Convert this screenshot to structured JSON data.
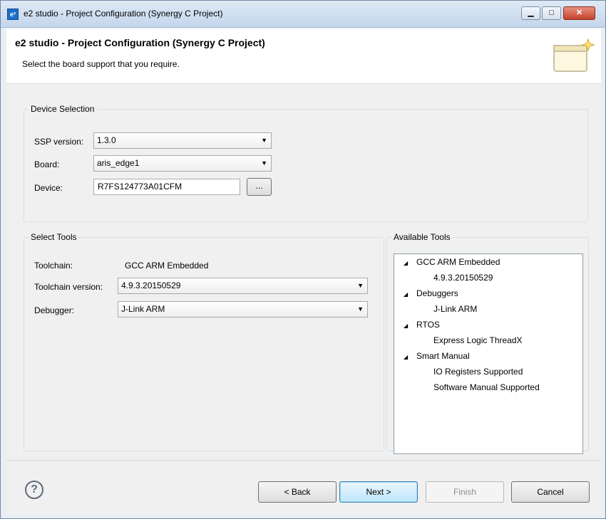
{
  "window": {
    "title": "e2 studio - Project Configuration  (Synergy C Project)",
    "icon": "e2-studio-icon",
    "controls": [
      "minimize-icon",
      "maximize-icon",
      "close-icon"
    ]
  },
  "header": {
    "title": "e2 studio - Project Configuration  (Synergy C Project)",
    "subtitle": "Select the board support that you require."
  },
  "device_selection": {
    "legend": "Device Selection",
    "ssp_version_label": "SSP version:",
    "ssp_version_value": "1.3.0",
    "board_label": "Board:",
    "board_value": "aris_edge1",
    "device_label": "Device:",
    "device_value": "R7FS124773A01CFM",
    "browse_label": "..."
  },
  "select_tools": {
    "legend": "Select Tools",
    "toolchain_label": "Toolchain:",
    "toolchain_value": "GCC ARM Embedded",
    "toolchain_version_label": "Toolchain version:",
    "toolchain_version_value": "4.9.3.20150529",
    "debugger_label": "Debugger:",
    "debugger_value": "J-Link ARM"
  },
  "available_tools": {
    "legend": "Available Tools",
    "tree": [
      {
        "label": "GCC ARM Embedded",
        "children": [
          "4.9.3.20150529"
        ]
      },
      {
        "label": "Debuggers",
        "children": [
          "J-Link ARM"
        ]
      },
      {
        "label": "RTOS",
        "children": [
          "Express Logic ThreadX"
        ]
      },
      {
        "label": "Smart Manual",
        "children": [
          "IO Registers Supported",
          "Software Manual Supported"
        ]
      }
    ]
  },
  "footer": {
    "help_icon": "help-icon",
    "back_label": "< Back",
    "next_label": "Next >",
    "finish_label": "Finish",
    "cancel_label": "Cancel"
  },
  "colors": {
    "titlebar": "#c4d6ec",
    "close_button": "#c2422b",
    "default_button": "#bee6fd"
  }
}
